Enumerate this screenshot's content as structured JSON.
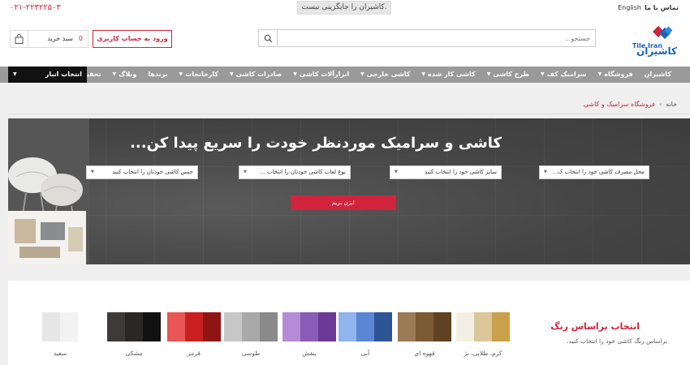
{
  "topbar": {
    "contact": "تماس با ما",
    "lang": "English",
    "slogan": "کاشیران را جایگزینی نیست.",
    "phone": "۰۲۱-۲۲۳۲۲۵۰۳"
  },
  "header": {
    "logo_tile": "Tile Iran",
    "logo_name": "کاشیران",
    "search_placeholder": "جستجو...",
    "login_label": "ورود به حساب کاربری",
    "cart_label": "سبد خرید",
    "cart_count": "0"
  },
  "nav": {
    "items": [
      {
        "label": "کاشیران",
        "dropdown": false
      },
      {
        "label": "فروشگاه",
        "dropdown": true
      },
      {
        "label": "سرامیک کف",
        "dropdown": true
      },
      {
        "label": "طرح کاشی",
        "dropdown": true
      },
      {
        "label": "کاشی کار شده",
        "dropdown": true
      },
      {
        "label": "کاشی خارجی",
        "dropdown": true
      },
      {
        "label": "ابزارآلات کاشی",
        "dropdown": true
      },
      {
        "label": "صادرات کاشی",
        "dropdown": true
      },
      {
        "label": "کارخانجات",
        "dropdown": true
      },
      {
        "label": "برندها",
        "dropdown": false
      },
      {
        "label": "وبلاگ",
        "dropdown": true
      },
      {
        "label": "تخفیفات",
        "dropdown": false
      }
    ],
    "warehouse": "انتخاب انبار"
  },
  "breadcrumb": {
    "home": "خانه",
    "separator": "›",
    "current": "فروشگاه سرامیک و کاشی"
  },
  "hero": {
    "heading": "کاشی و سرامیک موردنظر خودت را سریع پیدا کن...",
    "selects": [
      "محل مصرف کاشی خود را انتخاب ک...",
      "سایز کاشی خود را انتخاب کنید",
      "نوع لعاب کاشی خودتان را انتخاب ...",
      "جنس کاشی خودتان را انتخاب کنید"
    ],
    "button": "بزن بریم!"
  },
  "colors": {
    "title": "انتخاب براساس رنگ",
    "subtitle": "براساس رنگ کاشی خود را انتخاب کنید.",
    "swatches": [
      {
        "label": "کرم، طلایی، بژ",
        "colors": [
          "#f3efe2",
          "#dcc79a",
          "#c9a14a"
        ]
      },
      {
        "label": "قهوه ای",
        "colors": [
          "#9b7b55",
          "#7b5a33",
          "#5f4222"
        ]
      },
      {
        "label": "آبی",
        "colors": [
          "#8fb4ee",
          "#5a86d6",
          "#2f5496"
        ]
      },
      {
        "label": "بنفش",
        "colors": [
          "#b68ad6",
          "#8a5cb8",
          "#6b3a96"
        ]
      },
      {
        "label": "طوسی",
        "colors": [
          "#c7c7c7",
          "#a9a9a9",
          "#8a8a8a"
        ]
      },
      {
        "label": "قرمز",
        "colors": [
          "#e85656",
          "#c8201f",
          "#8f1414"
        ]
      },
      {
        "label": "مشکی",
        "colors": [
          "#3e3a39",
          "#2a2727",
          "#111111"
        ]
      },
      {
        "label": "سفید",
        "colors": [
          "#e6e6e6",
          "#f2f2f2"
        ]
      }
    ]
  }
}
